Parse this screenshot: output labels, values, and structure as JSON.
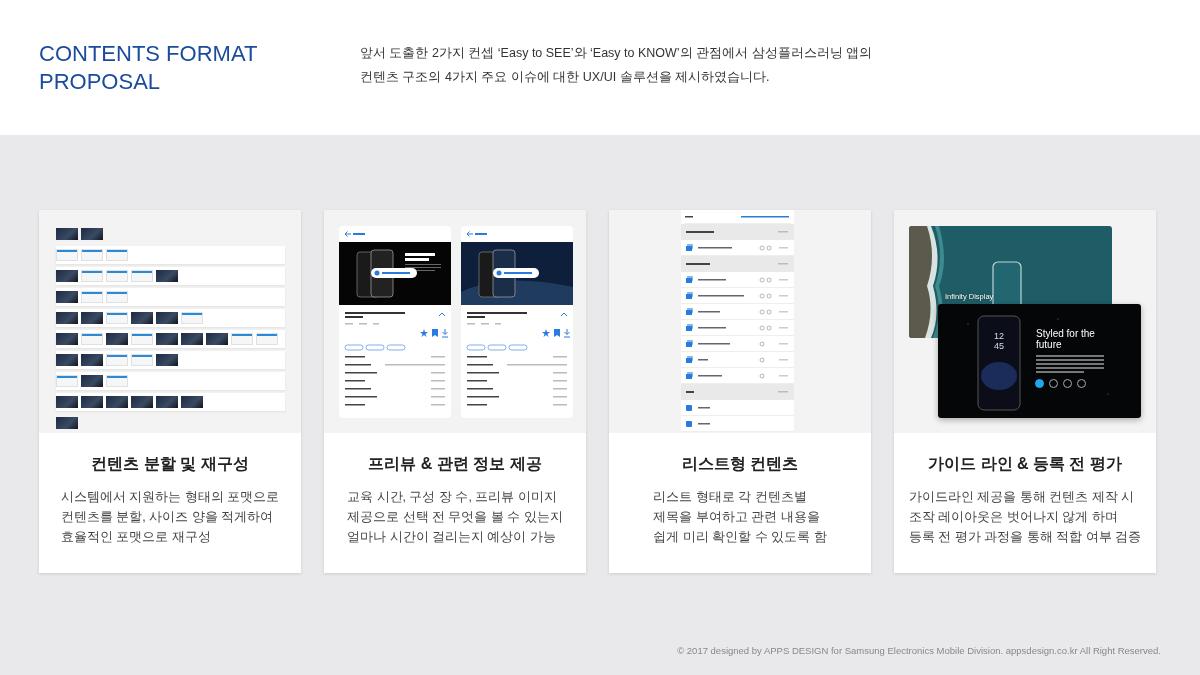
{
  "header": {
    "title": "CONTENTS FORMAT PROPOSAL",
    "intro_lines": [
      "앞서 도출한 2가지 컨셉  ‘Easy to SEE’와 ‘Easy to KNOW’의 관점에서 삼성플러스러닝 앱의",
      "컨텐츠 구조의 4가지 주요 이슈에 대한 UX/UI 솔루션을 제시하였습니다."
    ]
  },
  "cards": [
    {
      "kind": "thumbnails",
      "title": "컨텐츠 분할 및 재구성",
      "description": [
        "시스템에서 지원하는 형태의 포맷으로",
        "컨텐츠를 분할, 사이즈 양을 적게하여",
        "효율적인 포맷으로 재구성"
      ],
      "rows": [
        {
          "framed": false,
          "thumbs": [
            {
              "kind": "dark"
            },
            {
              "kind": "dark"
            }
          ]
        },
        {
          "framed": true,
          "thumbs": [
            {
              "kind": "light"
            },
            {
              "kind": "light"
            },
            {
              "kind": "light"
            }
          ]
        },
        {
          "framed": true,
          "thumbs": [
            {
              "kind": "dark"
            },
            {
              "kind": "light"
            },
            {
              "kind": "light"
            },
            {
              "kind": "light"
            },
            {
              "kind": "dark"
            }
          ]
        },
        {
          "framed": true,
          "thumbs": [
            {
              "kind": "dark"
            },
            {
              "kind": "light"
            },
            {
              "kind": "light"
            }
          ]
        },
        {
          "framed": true,
          "thumbs": [
            {
              "kind": "dark"
            },
            {
              "kind": "dark"
            },
            {
              "kind": "light"
            },
            {
              "kind": "dark"
            },
            {
              "kind": "dark"
            },
            {
              "kind": "light"
            }
          ]
        },
        {
          "framed": true,
          "thumbs": [
            {
              "kind": "dark"
            },
            {
              "kind": "light"
            },
            {
              "kind": "dark"
            },
            {
              "kind": "light"
            },
            {
              "kind": "dark"
            },
            {
              "kind": "dark"
            },
            {
              "kind": "dark"
            },
            {
              "kind": "light"
            },
            {
              "kind": "light"
            }
          ]
        },
        {
          "framed": true,
          "thumbs": [
            {
              "kind": "dark"
            },
            {
              "kind": "dark"
            },
            {
              "kind": "light"
            },
            {
              "kind": "light"
            },
            {
              "kind": "dark"
            }
          ]
        },
        {
          "framed": true,
          "thumbs": [
            {
              "kind": "light"
            },
            {
              "kind": "dark"
            },
            {
              "kind": "light"
            }
          ]
        },
        {
          "framed": true,
          "thumbs": [
            {
              "kind": "dark"
            },
            {
              "kind": "dark"
            },
            {
              "kind": "dark"
            },
            {
              "kind": "dark"
            },
            {
              "kind": "dark"
            },
            {
              "kind": "dark"
            }
          ]
        },
        {
          "framed": false,
          "thumbs": [
            {
              "kind": "dark"
            }
          ]
        }
      ]
    },
    {
      "kind": "detail",
      "title": "프리뷰 & 관련 정보 제공",
      "description": [
        "교육 시간, 구성 장 수, 프리뷰 이미지",
        "제공으로 선택 전 무엇을 볼 수 있는지",
        "얼마나 시간이 걸리는지 예상이 가능"
      ]
    },
    {
      "kind": "list",
      "title": "리스트형 컨텐츠",
      "description": [
        "리스트 형태로 각 컨텐츠별",
        "제목을 부여하고 관련 내용을",
        "쉽게 미리 확인할 수 있도록 함"
      ]
    },
    {
      "kind": "guide",
      "title": "가이드 라인 & 등록 전 평가",
      "description": [
        "가이드라인 제공을 통해 컨텐츠 제작 시",
        "조작 레이아웃은 벗어나지 않게 하며",
        "등록 전 평가 과정을 통해 적합 여부 검증"
      ],
      "back_label": "Infinity Display",
      "slide_title": "Styled for the future",
      "clock": [
        "12",
        "45"
      ],
      "nav": [
        {
          "selected": true
        },
        {
          "selected": false
        },
        {
          "selected": false
        },
        {
          "selected": false
        }
      ]
    }
  ],
  "footer": "© 2017 designed by  APPS DESIGN for Samsung Electronics Mobile Division.  appsdesign.co.kr  All Right Reserved."
}
